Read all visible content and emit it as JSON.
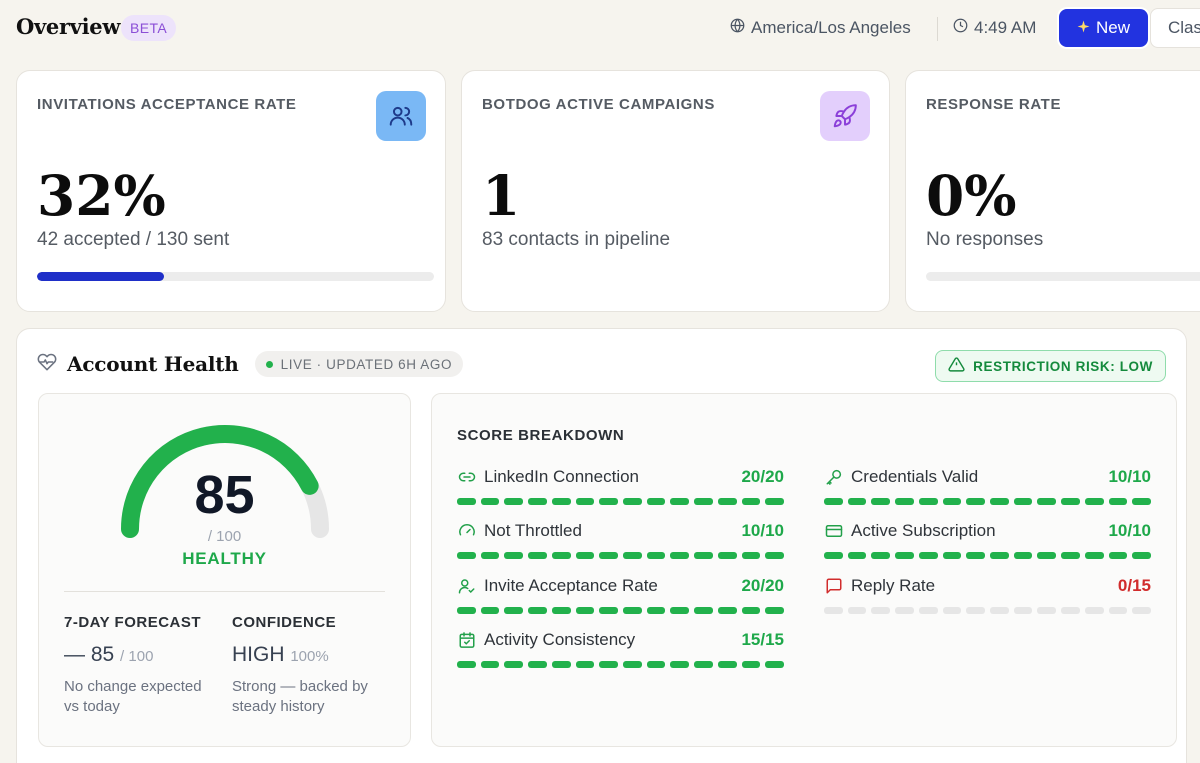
{
  "header": {
    "title": "Overview",
    "badge": "BETA",
    "timezone": "America/Los Angeles",
    "time": "4:49 AM",
    "new_button": "New",
    "class_button": "Clas"
  },
  "cards": [
    {
      "label": "INVITATIONS ACCEPTANCE RATE",
      "value": "32%",
      "sub": "42 accepted / 130 sent",
      "progress": 0.32,
      "icon": "users-icon"
    },
    {
      "label": "BOTDOG ACTIVE CAMPAIGNS",
      "value": "1",
      "sub": "83 contacts in pipeline",
      "icon": "rocket-icon"
    },
    {
      "label": "RESPONSE RATE",
      "value": "0%",
      "sub": "No responses",
      "progress": 0
    }
  ],
  "health": {
    "title": "Account Health",
    "live": "LIVE · UPDATED 6H AGO",
    "risk": "RESTRICTION RISK: LOW",
    "score": "85",
    "score_value": 85,
    "score_max": "/ 100",
    "status": "HEALTHY",
    "forecast": {
      "label": "7-DAY FORECAST",
      "value": "— 85",
      "unit": "/ 100",
      "note": "No change expected vs today"
    },
    "confidence": {
      "label": "CONFIDENCE",
      "value": "HIGH",
      "unit": "100%",
      "note": "Strong — backed by steady history"
    }
  },
  "breakdown": {
    "title": "SCORE BREAKDOWN",
    "items": [
      {
        "label": "LinkedIn Connection",
        "score": "20/20",
        "fraction": 1,
        "icon": "link-icon"
      },
      {
        "label": "Not Throttled",
        "score": "10/10",
        "fraction": 1,
        "icon": "gauge-icon"
      },
      {
        "label": "Invite Acceptance Rate",
        "score": "20/20",
        "fraction": 1,
        "icon": "user-check-icon"
      },
      {
        "label": "Activity Consistency",
        "score": "15/15",
        "fraction": 1,
        "icon": "calendar-check-icon"
      },
      {
        "label": "Credentials Valid",
        "score": "10/10",
        "fraction": 1,
        "icon": "key-icon"
      },
      {
        "label": "Active Subscription",
        "score": "10/10",
        "fraction": 1,
        "icon": "credit-card-icon"
      },
      {
        "label": "Reply Rate",
        "score": "0/15",
        "fraction": 0,
        "icon": "message-icon"
      }
    ]
  },
  "colors": {
    "accent": "#2233e0",
    "good": "#22b14c",
    "bad": "#d12c2c",
    "track": "#e6e6e6"
  }
}
